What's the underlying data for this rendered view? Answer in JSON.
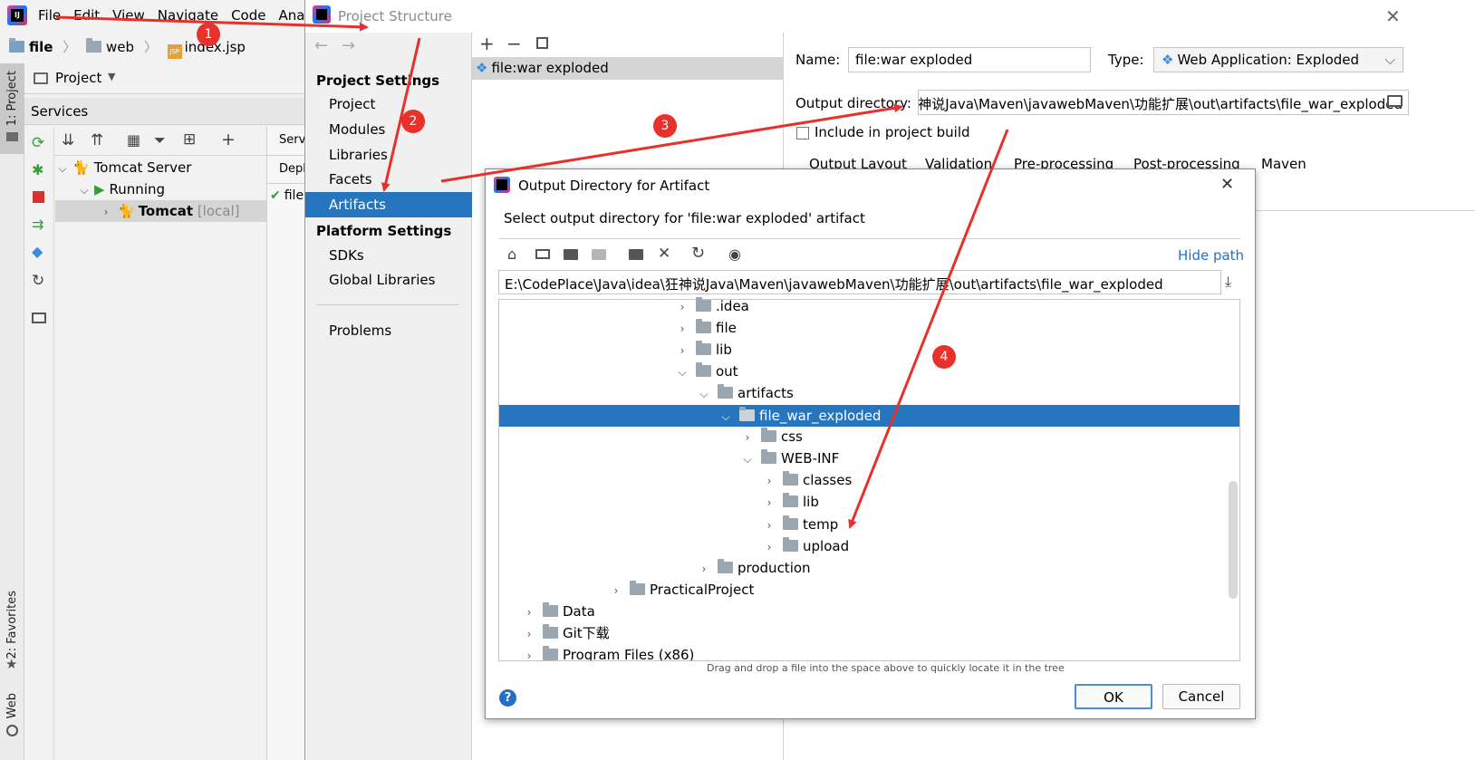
{
  "ide": {
    "menu": [
      "File",
      "Edit",
      "View",
      "Navigate",
      "Code",
      "Anal"
    ],
    "breadcrumb": [
      "file",
      "web",
      "index.jsp"
    ],
    "project_dropdown": "Project",
    "services_title": "Services",
    "tree": {
      "tomcat_server": "Tomcat Server",
      "running": "Running",
      "tomcat": "Tomcat",
      "local": "[local]"
    },
    "cut_tabs": {
      "serv": "Serv",
      "depl": "Depl",
      "file": "file"
    },
    "left_tabs": {
      "project": "1: Project",
      "favorites": "2: Favorites",
      "web": "Web"
    }
  },
  "project_structure": {
    "title": "Project Structure",
    "project_settings_header": "Project Settings",
    "project_settings": [
      "Project",
      "Modules",
      "Libraries",
      "Facets",
      "Artifacts"
    ],
    "platform_settings_header": "Platform Settings",
    "platform_settings": [
      "SDKs",
      "Global Libraries"
    ],
    "problems": "Problems",
    "artifact_item": "file:war exploded",
    "name_label": "Name:",
    "name_value": "file:war exploded",
    "type_label": "Type:",
    "type_value": "Web Application: Exploded",
    "output_dir_label": "Output directory:",
    "output_dir_value": "神说Java\\Maven\\javawebMaven\\功能扩展\\out\\artifacts\\file_war_exploded",
    "include_label": "Include in project build",
    "tabs": [
      "Output Layout",
      "Validation",
      "Pre-processing",
      "Post-processing",
      "Maven"
    ]
  },
  "dialog": {
    "title": "Output Directory for Artifact",
    "subtitle": "Select output directory for 'file:war exploded' artifact",
    "hide_path": "Hide path",
    "path": "E:\\CodePlace\\Java\\idea\\狂神说Java\\Maven\\javawebMaven\\功能扩展\\out\\artifacts\\file_war_exploded",
    "tree": [
      ".idea",
      "file",
      "lib",
      "out",
      "artifacts",
      "file_war_exploded",
      "css",
      "WEB-INF",
      "classes",
      "lib",
      "temp",
      "upload",
      "production",
      "PracticalProject",
      "Data",
      "Git下载",
      "Program Files (x86)"
    ],
    "hint": "Drag and drop a file into the space above to quickly locate it in the tree",
    "ok": "OK",
    "cancel": "Cancel"
  },
  "annotations": [
    "1",
    "2",
    "3",
    "4"
  ],
  "colors": {
    "selection": "#2675bf",
    "annotation": "#e8312a",
    "link": "#2470c9"
  }
}
